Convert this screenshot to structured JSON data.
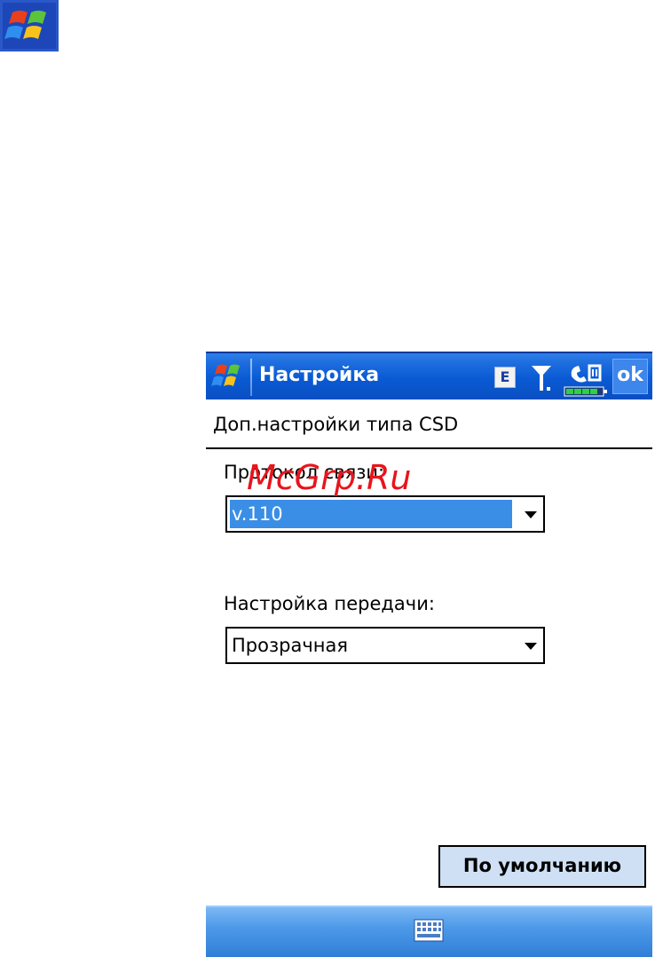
{
  "titlebar": {
    "title": "Настройка",
    "network_indicator": "E",
    "ok_label": "ok",
    "icons": {
      "start": "windows-flag-icon",
      "network": "edge-network-icon",
      "signal": "signal-antenna-icon",
      "phone": "phone-battery-icon"
    }
  },
  "page": {
    "header": "Доп.настройки типа CSD"
  },
  "fields": {
    "protocol": {
      "label": "Протокол связи:",
      "value": "v.110"
    },
    "transfer": {
      "label": "Настройка передачи:",
      "value": "Прозрачная"
    }
  },
  "buttons": {
    "default_label": "По умолчанию"
  },
  "bottombar": {
    "icon": "keyboard-icon"
  },
  "watermark": {
    "text": "McGrp.Ru"
  },
  "colors": {
    "titlebar": "#0a5ad4",
    "selection": "#3a8ee6",
    "button_face": "#cfe0f4",
    "watermark": "#e8141c"
  }
}
